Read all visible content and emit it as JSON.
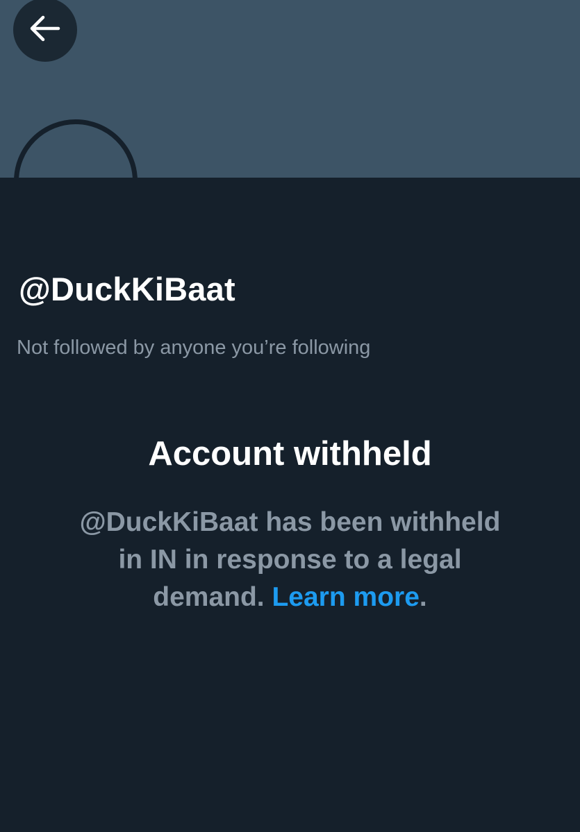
{
  "header": {
    "back_icon": "arrow-left-icon"
  },
  "profile": {
    "handle": "@DuckKiBaat",
    "followed_note": "Not followed by anyone you’re following"
  },
  "withheld": {
    "title": "Account withheld",
    "description_lines": [
      "@DuckKiBaat has been withheld",
      "in IN in response to a legal",
      "demand."
    ],
    "learn_more": "Learn more",
    "trailing_period": "."
  },
  "colors": {
    "background": "#15202b",
    "banner": "#3d5466",
    "muted_text": "#8b98a5",
    "link": "#1d9bf0"
  }
}
